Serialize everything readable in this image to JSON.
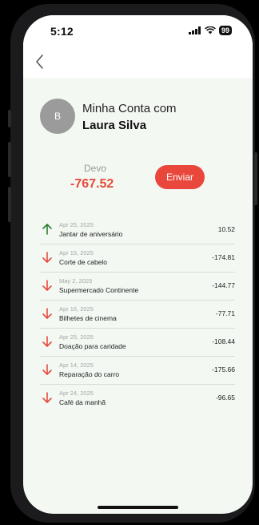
{
  "status_bar": {
    "time": "5:12",
    "battery": "99"
  },
  "account": {
    "avatar_initial": "B",
    "title_line1": "Minha Conta com",
    "title_line2": "Laura Silva"
  },
  "balance": {
    "label": "Devo",
    "value": "-767.52"
  },
  "send_button_label": "Enviar",
  "colors": {
    "negative": "#e64b3b",
    "positive": "#2e7d32",
    "accent_button": "#e9473b",
    "background": "#f3f8f3"
  },
  "transactions": [
    {
      "date": "Apr 25, 2025",
      "description": "Jantar de aniversário",
      "amount": "10.52",
      "direction": "up",
      "icon": "arrow-up-icon"
    },
    {
      "date": "Apr 15, 2025",
      "description": "Corte de cabelo",
      "amount": "-174.81",
      "direction": "down",
      "icon": "arrow-down-icon"
    },
    {
      "date": "May 2, 2025",
      "description": "Supermercado Continente",
      "amount": "-144.77",
      "direction": "down",
      "icon": "arrow-down-icon"
    },
    {
      "date": "Apr 16, 2025",
      "description": "Bilhetes de cinema",
      "amount": "-77.71",
      "direction": "down",
      "icon": "arrow-down-icon"
    },
    {
      "date": "Apr 25, 2025",
      "description": "Doação para caridade",
      "amount": "-108.44",
      "direction": "down",
      "icon": "arrow-down-icon"
    },
    {
      "date": "Apr 14, 2025",
      "description": "Reparação do carro",
      "amount": "-175.66",
      "direction": "down",
      "icon": "arrow-down-icon"
    },
    {
      "date": "Apr 24, 2025",
      "description": "Café da manhã",
      "amount": "-96.65",
      "direction": "down",
      "icon": "arrow-down-icon"
    }
  ]
}
